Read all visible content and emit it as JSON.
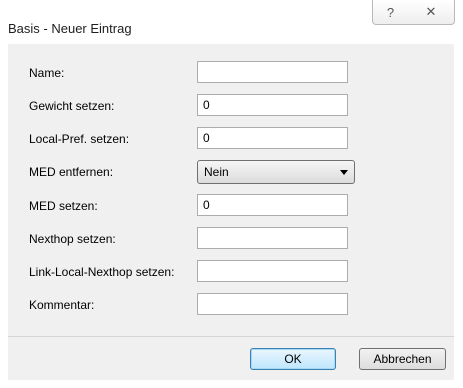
{
  "window": {
    "title": "Basis - Neuer Eintrag",
    "help_glyph": "?",
    "close_glyph": "✕"
  },
  "form": {
    "fields": [
      {
        "label": "Name:",
        "value": "",
        "type": "text"
      },
      {
        "label": "Gewicht setzen:",
        "value": "0",
        "type": "text"
      },
      {
        "label": "Local-Pref. setzen:",
        "value": "0",
        "type": "text"
      },
      {
        "label": "MED entfernen:",
        "value": "Nein",
        "type": "select"
      },
      {
        "label": "MED setzen:",
        "value": "0",
        "type": "text"
      },
      {
        "label": "Nexthop setzen:",
        "value": "",
        "type": "text"
      },
      {
        "label": "Link-Local-Nexthop setzen:",
        "value": "",
        "type": "text"
      },
      {
        "label": "Kommentar:",
        "value": "",
        "type": "text"
      }
    ]
  },
  "buttons": {
    "ok_label": "OK",
    "cancel_label": "Abbrechen"
  }
}
